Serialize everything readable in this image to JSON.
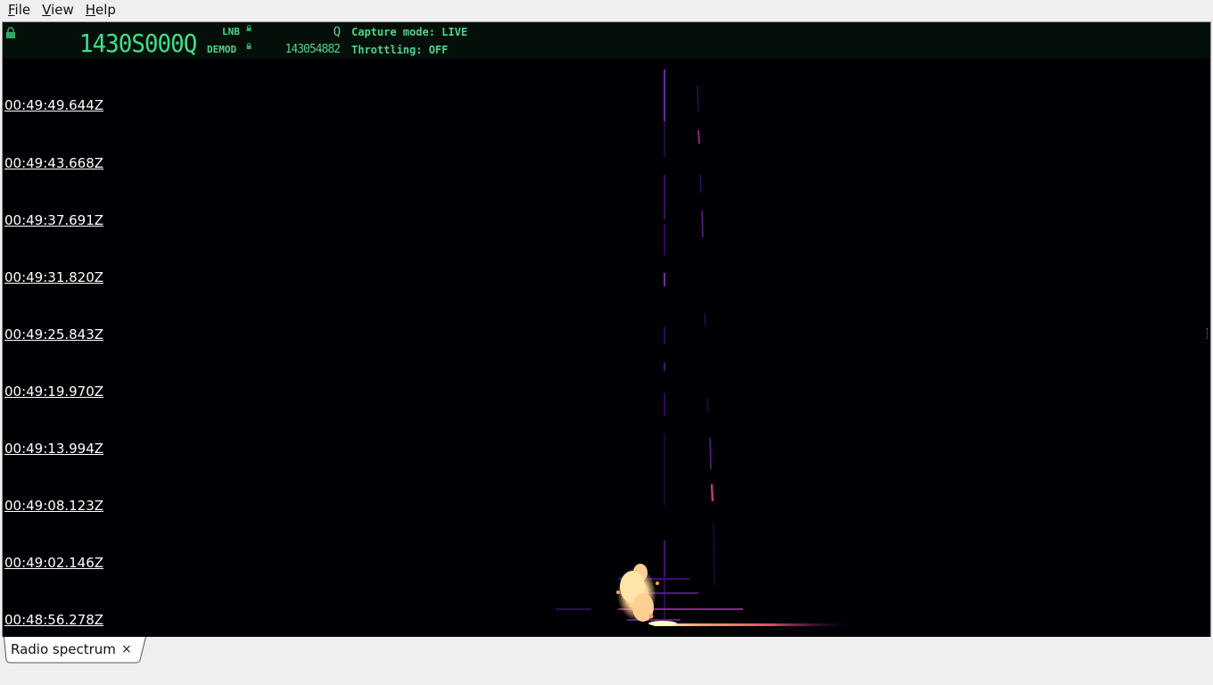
{
  "menu": {
    "items": [
      {
        "mnemonic": "F",
        "rest": "ile"
      },
      {
        "mnemonic": "V",
        "rest": "iew"
      },
      {
        "mnemonic": "H",
        "rest": "elp"
      }
    ]
  },
  "header": {
    "main_frequency": "1430S000Q",
    "lnb_label": "LNB",
    "lnb_value": "Q",
    "demod_label": "DEMOD",
    "demod_value": "143054882",
    "capture_mode": "Capture mode: LIVE",
    "throttling": "Throttling: OFF",
    "accent_color": "#4fd38a",
    "lock_icon": "lock-icon"
  },
  "waterfall": {
    "timestamps": [
      "00:49:49.644Z",
      "00:49:43.668Z",
      "00:49:37.691Z",
      "00:49:31.820Z",
      "00:49:25.843Z",
      "00:49:19.970Z",
      "00:49:13.994Z",
      "00:49:08.123Z",
      "00:49:02.146Z",
      "00:48:56.278Z"
    ],
    "colormap": [
      "#000004",
      "#3b0f70",
      "#8c2981",
      "#de4968",
      "#fe9f6d",
      "#fcfdbf"
    ]
  },
  "tabs": [
    {
      "label": "Radio spectrum",
      "close": "×",
      "active": true
    }
  ]
}
